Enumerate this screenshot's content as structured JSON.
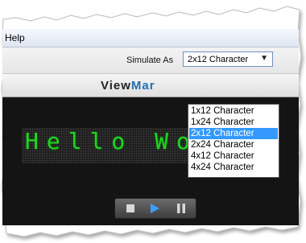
{
  "menubar": {
    "help_label": "Help"
  },
  "toolbar": {
    "simulate_label": "Simulate As",
    "selected_value": "2x12 Character"
  },
  "logo": {
    "part1": "View",
    "part2": "Mar"
  },
  "dropdown": {
    "options": [
      "1x12 Character",
      "1x24 Character",
      "2x12 Character",
      "2x24 Character",
      "4x12 Character",
      "4x24 Character"
    ],
    "selected_index": 2
  },
  "lcd": {
    "text": "Hello Wor"
  },
  "colors": {
    "lcd_text": "#22d422",
    "selection": "#3399ff",
    "logo_accent": "#1f6fb3"
  },
  "player": {
    "icons": [
      "stop-icon",
      "play-icon",
      "pause-icon"
    ]
  }
}
